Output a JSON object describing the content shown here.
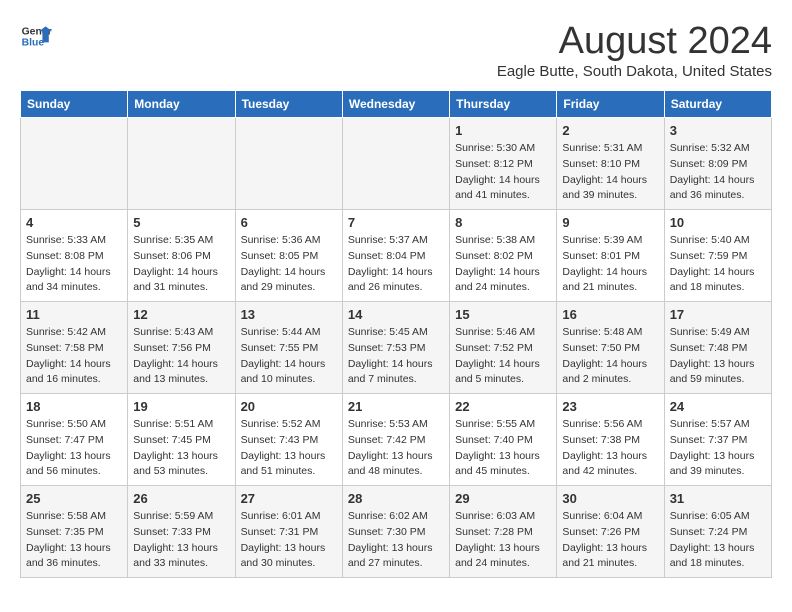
{
  "header": {
    "logo_line1": "General",
    "logo_line2": "Blue",
    "main_title": "August 2024",
    "subtitle": "Eagle Butte, South Dakota, United States"
  },
  "days_of_week": [
    "Sunday",
    "Monday",
    "Tuesday",
    "Wednesday",
    "Thursday",
    "Friday",
    "Saturday"
  ],
  "weeks": [
    [
      {
        "day": "",
        "info": ""
      },
      {
        "day": "",
        "info": ""
      },
      {
        "day": "",
        "info": ""
      },
      {
        "day": "",
        "info": ""
      },
      {
        "day": "1",
        "info": "Sunrise: 5:30 AM\nSunset: 8:12 PM\nDaylight: 14 hours\nand 41 minutes."
      },
      {
        "day": "2",
        "info": "Sunrise: 5:31 AM\nSunset: 8:10 PM\nDaylight: 14 hours\nand 39 minutes."
      },
      {
        "day": "3",
        "info": "Sunrise: 5:32 AM\nSunset: 8:09 PM\nDaylight: 14 hours\nand 36 minutes."
      }
    ],
    [
      {
        "day": "4",
        "info": "Sunrise: 5:33 AM\nSunset: 8:08 PM\nDaylight: 14 hours\nand 34 minutes."
      },
      {
        "day": "5",
        "info": "Sunrise: 5:35 AM\nSunset: 8:06 PM\nDaylight: 14 hours\nand 31 minutes."
      },
      {
        "day": "6",
        "info": "Sunrise: 5:36 AM\nSunset: 8:05 PM\nDaylight: 14 hours\nand 29 minutes."
      },
      {
        "day": "7",
        "info": "Sunrise: 5:37 AM\nSunset: 8:04 PM\nDaylight: 14 hours\nand 26 minutes."
      },
      {
        "day": "8",
        "info": "Sunrise: 5:38 AM\nSunset: 8:02 PM\nDaylight: 14 hours\nand 24 minutes."
      },
      {
        "day": "9",
        "info": "Sunrise: 5:39 AM\nSunset: 8:01 PM\nDaylight: 14 hours\nand 21 minutes."
      },
      {
        "day": "10",
        "info": "Sunrise: 5:40 AM\nSunset: 7:59 PM\nDaylight: 14 hours\nand 18 minutes."
      }
    ],
    [
      {
        "day": "11",
        "info": "Sunrise: 5:42 AM\nSunset: 7:58 PM\nDaylight: 14 hours\nand 16 minutes."
      },
      {
        "day": "12",
        "info": "Sunrise: 5:43 AM\nSunset: 7:56 PM\nDaylight: 14 hours\nand 13 minutes."
      },
      {
        "day": "13",
        "info": "Sunrise: 5:44 AM\nSunset: 7:55 PM\nDaylight: 14 hours\nand 10 minutes."
      },
      {
        "day": "14",
        "info": "Sunrise: 5:45 AM\nSunset: 7:53 PM\nDaylight: 14 hours\nand 7 minutes."
      },
      {
        "day": "15",
        "info": "Sunrise: 5:46 AM\nSunset: 7:52 PM\nDaylight: 14 hours\nand 5 minutes."
      },
      {
        "day": "16",
        "info": "Sunrise: 5:48 AM\nSunset: 7:50 PM\nDaylight: 14 hours\nand 2 minutes."
      },
      {
        "day": "17",
        "info": "Sunrise: 5:49 AM\nSunset: 7:48 PM\nDaylight: 13 hours\nand 59 minutes."
      }
    ],
    [
      {
        "day": "18",
        "info": "Sunrise: 5:50 AM\nSunset: 7:47 PM\nDaylight: 13 hours\nand 56 minutes."
      },
      {
        "day": "19",
        "info": "Sunrise: 5:51 AM\nSunset: 7:45 PM\nDaylight: 13 hours\nand 53 minutes."
      },
      {
        "day": "20",
        "info": "Sunrise: 5:52 AM\nSunset: 7:43 PM\nDaylight: 13 hours\nand 51 minutes."
      },
      {
        "day": "21",
        "info": "Sunrise: 5:53 AM\nSunset: 7:42 PM\nDaylight: 13 hours\nand 48 minutes."
      },
      {
        "day": "22",
        "info": "Sunrise: 5:55 AM\nSunset: 7:40 PM\nDaylight: 13 hours\nand 45 minutes."
      },
      {
        "day": "23",
        "info": "Sunrise: 5:56 AM\nSunset: 7:38 PM\nDaylight: 13 hours\nand 42 minutes."
      },
      {
        "day": "24",
        "info": "Sunrise: 5:57 AM\nSunset: 7:37 PM\nDaylight: 13 hours\nand 39 minutes."
      }
    ],
    [
      {
        "day": "25",
        "info": "Sunrise: 5:58 AM\nSunset: 7:35 PM\nDaylight: 13 hours\nand 36 minutes."
      },
      {
        "day": "26",
        "info": "Sunrise: 5:59 AM\nSunset: 7:33 PM\nDaylight: 13 hours\nand 33 minutes."
      },
      {
        "day": "27",
        "info": "Sunrise: 6:01 AM\nSunset: 7:31 PM\nDaylight: 13 hours\nand 30 minutes."
      },
      {
        "day": "28",
        "info": "Sunrise: 6:02 AM\nSunset: 7:30 PM\nDaylight: 13 hours\nand 27 minutes."
      },
      {
        "day": "29",
        "info": "Sunrise: 6:03 AM\nSunset: 7:28 PM\nDaylight: 13 hours\nand 24 minutes."
      },
      {
        "day": "30",
        "info": "Sunrise: 6:04 AM\nSunset: 7:26 PM\nDaylight: 13 hours\nand 21 minutes."
      },
      {
        "day": "31",
        "info": "Sunrise: 6:05 AM\nSunset: 7:24 PM\nDaylight: 13 hours\nand 18 minutes."
      }
    ]
  ]
}
